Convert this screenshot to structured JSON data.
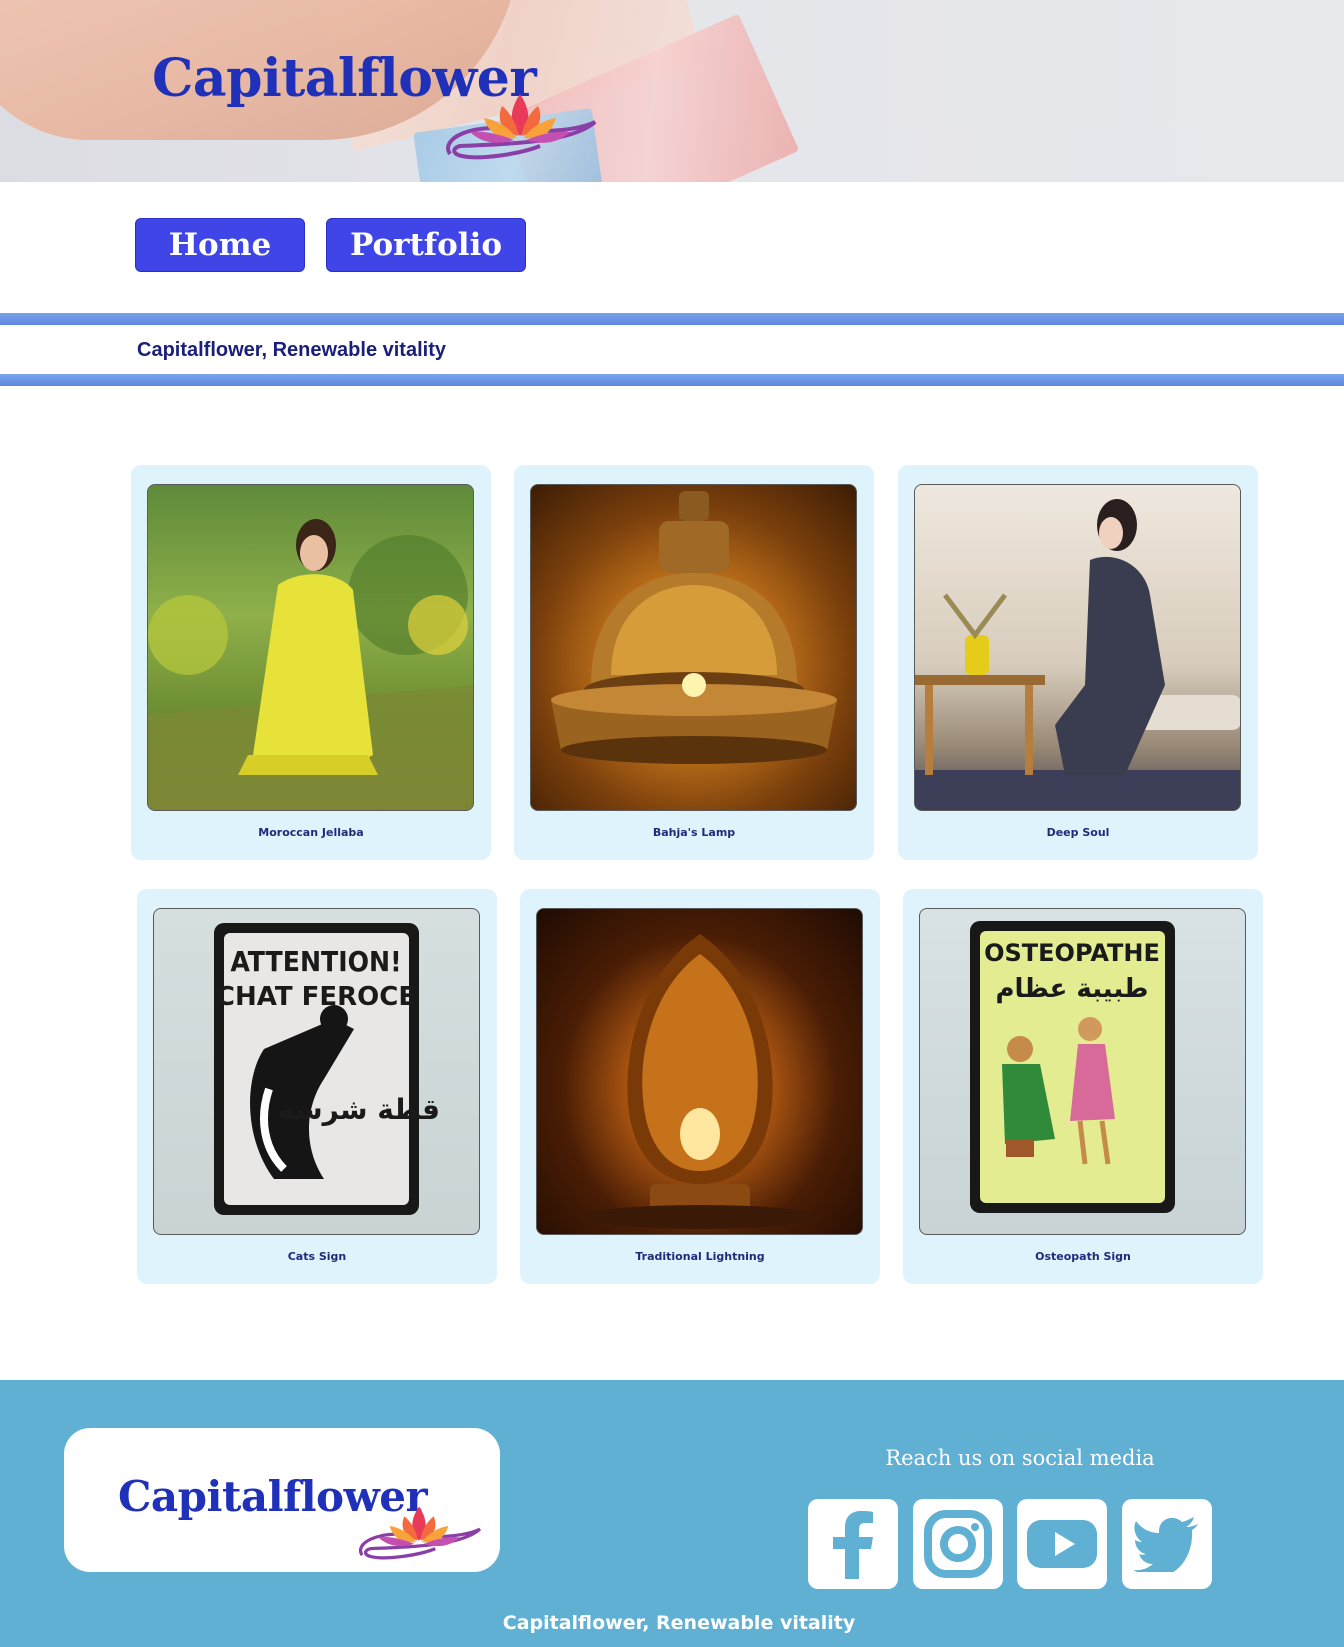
{
  "header": {
    "brand": "Capitalflower"
  },
  "nav": {
    "home_label": "Home",
    "portfolio_label": "Portfolio"
  },
  "tagline": "Capitalflower, Renewable vitality",
  "gallery": {
    "items": [
      {
        "caption": "Moroccan Jellaba"
      },
      {
        "caption": "Bahja's Lamp"
      },
      {
        "caption": "Deep Soul"
      },
      {
        "caption": "Cats Sign"
      },
      {
        "caption": "Traditional Lightning"
      },
      {
        "caption": "Osteopath Sign"
      }
    ]
  },
  "photo_text": {
    "cats_line1": "ATTENTION!",
    "cats_line2": "CHAT FEROCE",
    "cats_arabic": "قطة شرسة",
    "osteo_line1": "OSTEOPATHE",
    "osteo_arabic": "طبيبة عظام"
  },
  "footer": {
    "brand": "Capitalflower",
    "social_heading": "Reach us on social media",
    "social_icons": [
      "facebook-icon",
      "instagram-icon",
      "youtube-icon",
      "twitter-icon"
    ],
    "tagline": "Capitalflower, Renewable vitality"
  },
  "colors": {
    "brand_blue": "#2031b9",
    "nav_button": "#3f45e6",
    "band_blue": "#5b87e0",
    "card_bg": "#dff3fd",
    "footer_bg": "#5fb0d3"
  }
}
